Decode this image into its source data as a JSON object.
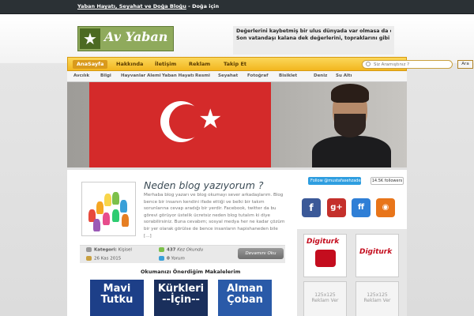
{
  "topbar": {
    "site_link": "Yaban Hayatı, Seyahat ve Doğa Bloğu",
    "tagline": " - Doğa için"
  },
  "header": {
    "logo_text": "Av Yaban",
    "slogan_line1": "Değerlerini kaybetmiş bir ulus dünyada var olmasa da olur.",
    "slogan_line2": "Son vatandaşı kalana dek değerlerini, topraklarını gibi korumalısın."
  },
  "main_nav": {
    "items": [
      {
        "label": "AnaSayfa",
        "active": true
      },
      {
        "label": "Hakkında",
        "active": false
      },
      {
        "label": "İletişim",
        "active": false
      },
      {
        "label": "Reklam",
        "active": false
      },
      {
        "label": "Takip Et",
        "active": false
      }
    ],
    "search_placeholder": "Siz Aramıştınız ?",
    "search_button": "Ara"
  },
  "sub_nav": {
    "items": [
      "Avcılık",
      "Bilgi",
      "Hayvanlar Alemi",
      "Yaban Hayatı",
      "Resmi",
      "Seyahat",
      "Fotoğraf",
      "Bisiklet",
      "Deniz",
      "Su Altı"
    ]
  },
  "post": {
    "title": "Neden blog yazıyorum ?",
    "excerpt": "Merhaba blog yazarı ve blog okumayı sever arkadaşlarım. Blog bence bir insanın kendini ifade ettiği ve belki bir takım sorunlarına cevap aradığı bir yerdir. Facebook, twitter da bu görevi görüyor üstelik ücretsiz neden blog tutalım ki diye sorabilirsiniz. Buna cevabım; sosyal medya her ne kadar çözüm bir yer olarak görülse de bence insanların hapishaneden bile [...]",
    "category_label": "Kategori:",
    "category": "Kişisel",
    "date": "26 Kas 2015",
    "views": "437",
    "views_label": "Kez Okundu",
    "comments": "0",
    "comments_label": "Yorum",
    "read_more": "Devamını Oku"
  },
  "recommended": {
    "title": "Okumanızı Önerdiğim Makalelerim",
    "items": [
      "Mavi Tutku",
      "Kürkleri --İçin--",
      "Alman Çoban"
    ]
  },
  "sidebar": {
    "follow_button": "Follow @mustafasehzaden",
    "follower_count": "14.5K followers",
    "social_icons": [
      "facebook-icon",
      "google-plus-icon",
      "friendfeed-icon",
      "rss-icon"
    ],
    "ads": [
      {
        "brand": "Digiturk"
      },
      {
        "brand": "Digiturk"
      },
      {
        "size": "125x125",
        "label": "Reklam Ver"
      },
      {
        "size": "125x125",
        "label": "Reklam Ver"
      }
    ]
  },
  "colors": {
    "accent": "#f5c02a",
    "topbar": "#2b3135",
    "logo_green": "#8faa5c",
    "flag_red": "#d42a2a"
  }
}
